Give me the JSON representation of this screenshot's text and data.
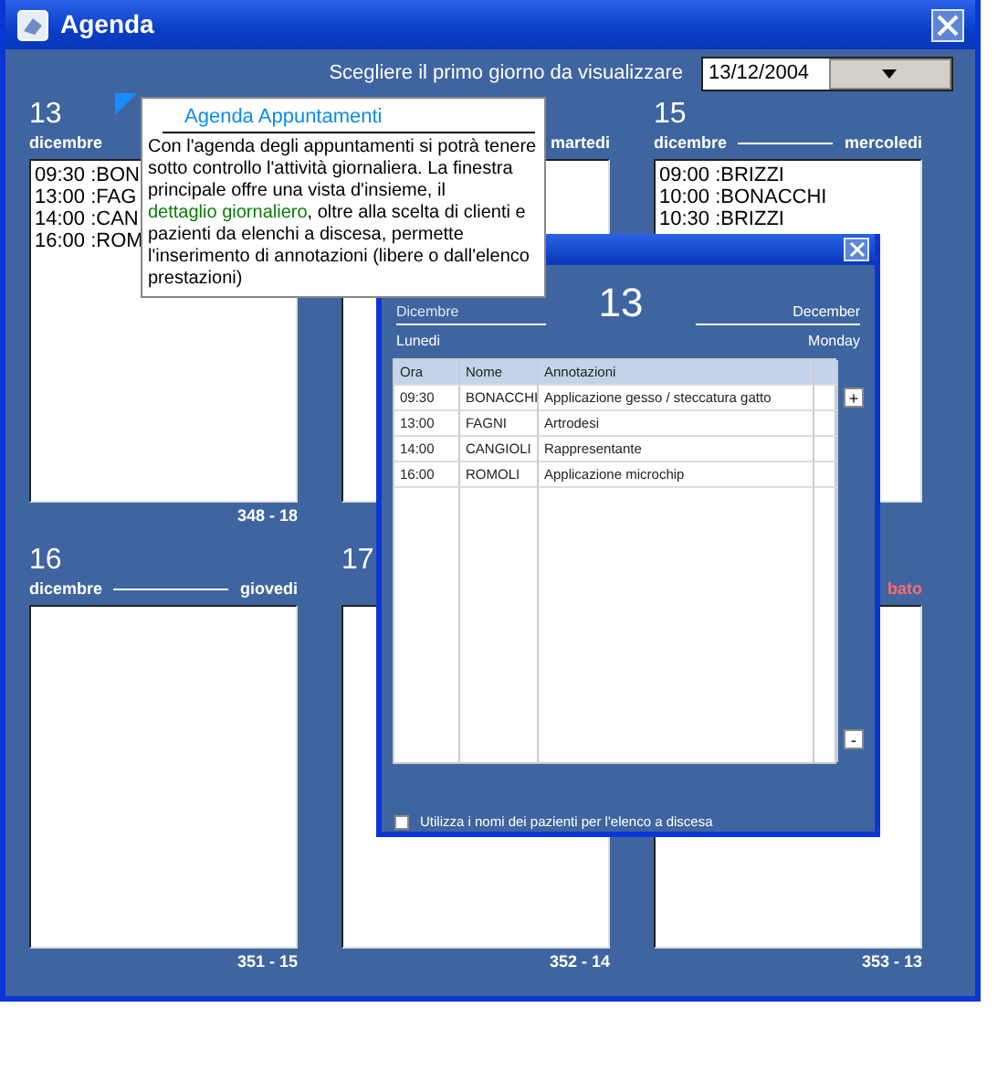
{
  "window": {
    "title": "Agenda"
  },
  "start_day": {
    "label": "Scegliere il primo giorno da visualizzare",
    "value": "13/12/2004"
  },
  "days": [
    {
      "day": "13",
      "month": "dicembre",
      "entries": [
        "09:30 :BON",
        "13:00 :FAG",
        "14:00 :CAN",
        "16:00 :ROM"
      ],
      "footer": "348 - 18"
    },
    {
      "weekday": "martedi",
      "weekend": false
    },
    {
      "day": "15",
      "month": "dicembre",
      "weekday": "mercoledi",
      "weekend": false,
      "entries": [
        "09:00 :BRIZZI",
        "10:00 :BONACCHI",
        "10:30 :BRIZZI"
      ]
    },
    {
      "day": "16",
      "month": "dicembre",
      "weekday": "giovedi",
      "weekend": false,
      "footer": "351 - 15"
    },
    {
      "day": "17",
      "footer": "352 - 14"
    },
    {
      "weekday": "bato",
      "weekend": true,
      "footer": "353 - 13"
    }
  ],
  "tooltip": {
    "title": "Agenda Appuntamenti",
    "parts": [
      {
        "kind": "plain",
        "text": "Con l'agenda degli appuntamenti si potrà tenere sotto controllo l'attività giornaliera. La finestra principale offre una vista d'insieme, il "
      },
      {
        "kind": "link",
        "text": "dettaglio giornaliero"
      },
      {
        "kind": "plain",
        "text": ", oltre alla scelta di clienti e pazienti da elenchi a discesa, permette l'inserimento di annotazioni (libere o dall'elenco prestazioni)"
      }
    ]
  },
  "detail": {
    "month": "Dicembre",
    "day": "13",
    "month_en": "December",
    "weekday": "Lunedi",
    "weekday_en": "Monday",
    "table": {
      "columns": [
        "Ora",
        "Nome",
        "Annotazioni",
        ""
      ],
      "rows": [
        [
          "09:30",
          "BONACCHI",
          "Applicazione gesso / steccatura gatto"
        ],
        [
          "13:00",
          "FAGNI",
          "Artrodesi"
        ],
        [
          "14:00",
          "CANGIOLI",
          "Rappresentante"
        ],
        [
          "16:00",
          "ROMOLI",
          "Applicazione microchip"
        ]
      ]
    },
    "add_button": "+",
    "remove_button": "-",
    "checkbox": {
      "label": "Utilizza i nomi dei pazienti per l'elenco a discesa",
      "checked": false
    }
  }
}
